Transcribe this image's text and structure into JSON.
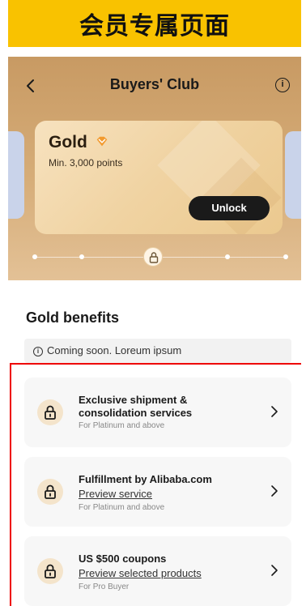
{
  "banner": {
    "title": "会员专属页面"
  },
  "nav": {
    "back_icon": "chevron-left-icon",
    "title": "Buyers' Club",
    "info_icon": "info-icon",
    "info_glyph": "i"
  },
  "tier": {
    "name": "Gold",
    "badge_icon": "diamond-icon",
    "requirement": "Min. 3,000 points",
    "unlock_label": "Unlock"
  },
  "section": {
    "title": "Gold benefits",
    "notice_icon": "info-icon",
    "notice_text": "Coming soon. Loreum ipsum"
  },
  "benefits": [
    {
      "title": "Exclusive shipment & consolidation services",
      "link": "",
      "note": "For Platinum and above"
    },
    {
      "title": "Fulfillment by Alibaba.com",
      "link": "Preview service",
      "note": "For Platinum and above"
    },
    {
      "title": "US $500 coupons",
      "link": "Preview selected products",
      "note": "For Pro Buyer"
    }
  ],
  "colors": {
    "banner": "#f9c200",
    "hero": "#d6ad79",
    "highlight": "#ee0000"
  }
}
